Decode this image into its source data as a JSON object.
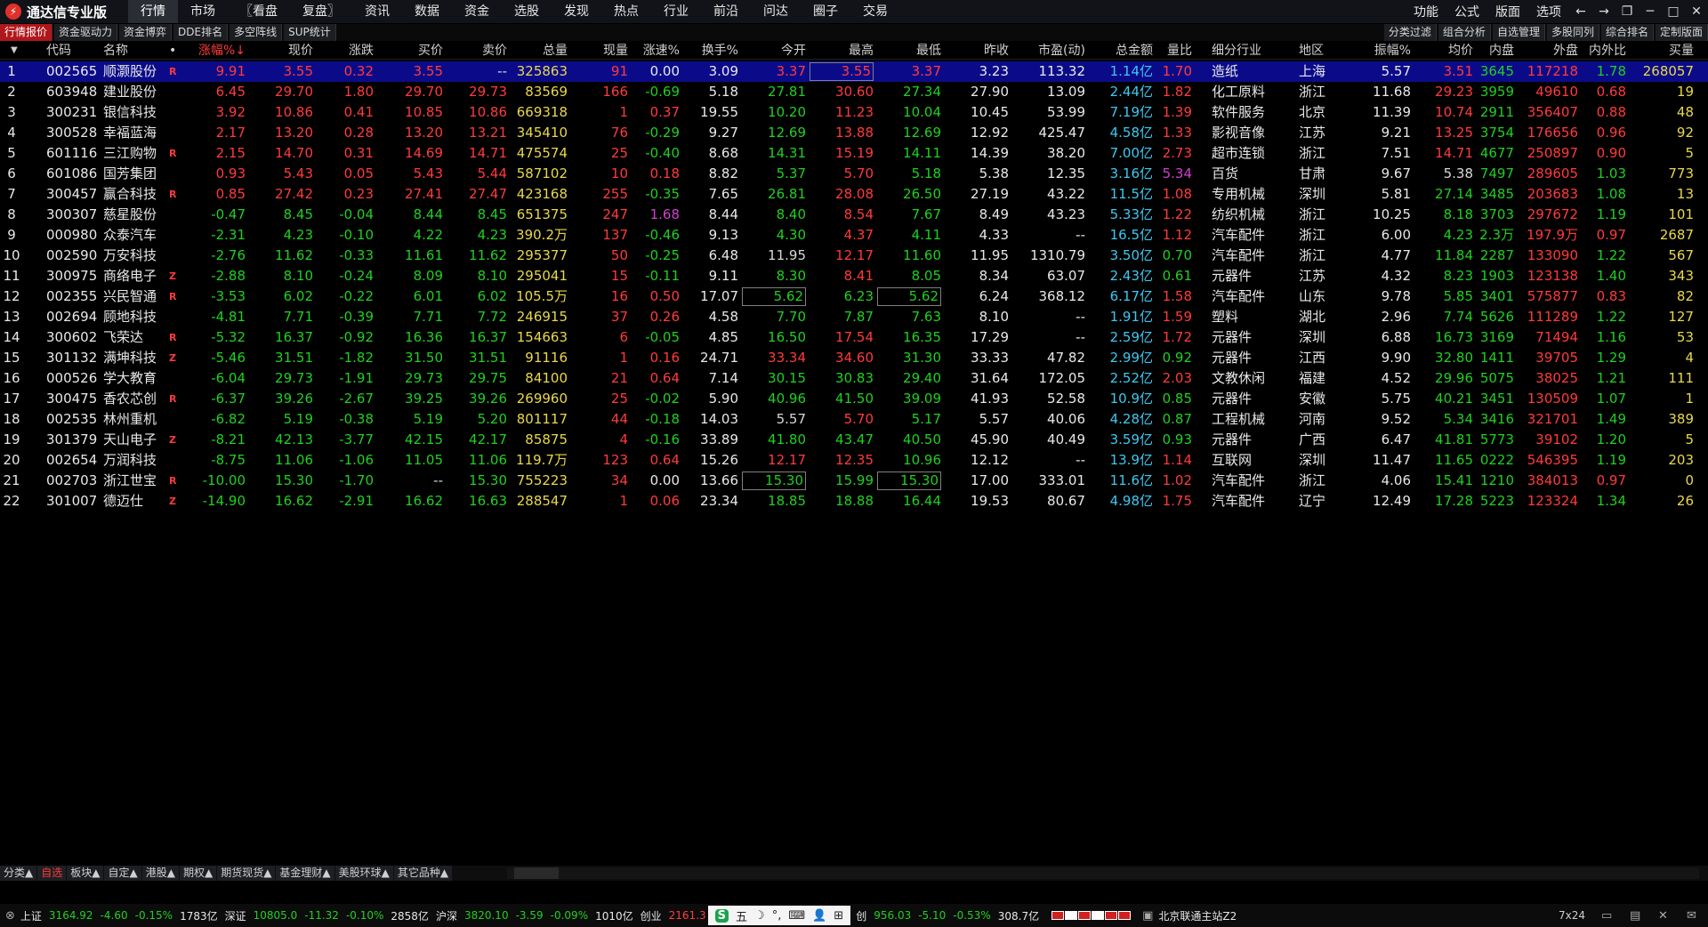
{
  "app": {
    "title": "通达信专业版",
    "logo_icon": "tdx-logo-icon"
  },
  "menu": [
    "行情",
    "市场",
    "〖看盘",
    "复盘〗",
    "资讯",
    "数据",
    "资金",
    "选股",
    "发现",
    "热点",
    "行业",
    "前沿",
    "问达",
    "圈子",
    "交易"
  ],
  "menu_active": 0,
  "top_right": [
    "功能",
    "公式",
    "版面",
    "选项"
  ],
  "window_icons": [
    "back-arrow-icon",
    "forward-arrow-icon",
    "restore-icon",
    "minimize-icon",
    "maximize-icon",
    "close-icon"
  ],
  "subtabs_left": [
    "行情报价",
    "资金驱动力",
    "资金博弈",
    "DDE排名",
    "多空阵线",
    "SUP统计"
  ],
  "subtabs_right": [
    "分类过滤",
    "组合分析",
    "自选管理",
    "多股同列",
    "综合排名",
    "定制版面"
  ],
  "columns": [
    "代码",
    "名称",
    "•",
    "涨幅%↓",
    "现价",
    "涨跌",
    "买价",
    "卖价",
    "总量",
    "现量",
    "涨速%",
    "换手%",
    "今开",
    "最高",
    "最低",
    "昨收",
    "市盈(动)",
    "总金额",
    "量比",
    "细分行业",
    "地区",
    "振幅%",
    "均价",
    "内盘",
    "外盘",
    "内外比",
    "买量"
  ],
  "rows": [
    {
      "n": "1",
      "code": "002565",
      "name": "顺灏股份",
      "flag": "R",
      "chg": "9.91",
      "price": "3.55",
      "diff": "0.32",
      "bid": "3.55",
      "ask": "--",
      "vol": "325863",
      "cur": "91",
      "spd": "0.00",
      "turn": "3.09",
      "open": "3.37",
      "high": "3.55",
      "low": "3.37",
      "prev": "3.23",
      "pe": "113.32",
      "amt": "1.14亿",
      "vr": "1.70",
      "ind": "造纸",
      "reg": "上海",
      "amp": "5.57",
      "avg": "3.51",
      "inner": "3645",
      "outer": "117218",
      "io": "1.78",
      "bv": "268057"
    },
    {
      "n": "2",
      "code": "603948",
      "name": "建业股份",
      "flag": "",
      "chg": "6.45",
      "price": "29.70",
      "diff": "1.80",
      "bid": "29.70",
      "ask": "29.73",
      "vol": "83569",
      "cur": "166",
      "spd": "-0.69",
      "turn": "5.18",
      "open": "27.81",
      "high": "30.60",
      "low": "27.34",
      "prev": "27.90",
      "pe": "13.09",
      "amt": "2.44亿",
      "vr": "1.82",
      "ind": "化工原料",
      "reg": "浙江",
      "amp": "11.68",
      "avg": "29.23",
      "inner": "3959",
      "outer": "49610",
      "io": "0.68",
      "bv": "19"
    },
    {
      "n": "3",
      "code": "300231",
      "name": "银信科技",
      "flag": "",
      "chg": "3.92",
      "price": "10.86",
      "diff": "0.41",
      "bid": "10.85",
      "ask": "10.86",
      "vol": "669318",
      "cur": "1",
      "spd": "0.37",
      "turn": "19.55",
      "open": "10.20",
      "high": "11.23",
      "low": "10.04",
      "prev": "10.45",
      "pe": "53.99",
      "amt": "7.19亿",
      "vr": "1.39",
      "ind": "软件服务",
      "reg": "北京",
      "amp": "11.39",
      "avg": "10.74",
      "inner": "2911",
      "outer": "356407",
      "io": "0.88",
      "bv": "48"
    },
    {
      "n": "4",
      "code": "300528",
      "name": "幸福蓝海",
      "flag": "",
      "chg": "2.17",
      "price": "13.20",
      "diff": "0.28",
      "bid": "13.20",
      "ask": "13.21",
      "vol": "345410",
      "cur": "76",
      "spd": "-0.29",
      "turn": "9.27",
      "open": "12.69",
      "high": "13.88",
      "low": "12.69",
      "prev": "12.92",
      "pe": "425.47",
      "amt": "4.58亿",
      "vr": "1.33",
      "ind": "影视音像",
      "reg": "江苏",
      "amp": "9.21",
      "avg": "13.25",
      "inner": "3754",
      "outer": "176656",
      "io": "0.96",
      "bv": "92"
    },
    {
      "n": "5",
      "code": "601116",
      "name": "三江购物",
      "flag": "R",
      "chg": "2.15",
      "price": "14.70",
      "diff": "0.31",
      "bid": "14.69",
      "ask": "14.71",
      "vol": "475574",
      "cur": "25",
      "spd": "-0.40",
      "turn": "8.68",
      "open": "14.31",
      "high": "15.19",
      "low": "14.11",
      "prev": "14.39",
      "pe": "38.20",
      "amt": "7.00亿",
      "vr": "2.73",
      "ind": "超市连锁",
      "reg": "浙江",
      "amp": "7.51",
      "avg": "14.71",
      "inner": "4677",
      "outer": "250897",
      "io": "0.90",
      "bv": "5"
    },
    {
      "n": "6",
      "code": "601086",
      "name": "国芳集团",
      "flag": "",
      "chg": "0.93",
      "price": "5.43",
      "diff": "0.05",
      "bid": "5.43",
      "ask": "5.44",
      "vol": "587102",
      "cur": "10",
      "spd": "0.18",
      "turn": "8.82",
      "open": "5.37",
      "high": "5.70",
      "low": "5.18",
      "prev": "5.38",
      "pe": "12.35",
      "amt": "3.16亿",
      "vr": "5.34",
      "ind": "百货",
      "reg": "甘肃",
      "amp": "9.67",
      "avg": "5.38",
      "inner": "7497",
      "outer": "289605",
      "io": "1.03",
      "bv": "773"
    },
    {
      "n": "7",
      "code": "300457",
      "name": "赢合科技",
      "flag": "R",
      "chg": "0.85",
      "price": "27.42",
      "diff": "0.23",
      "bid": "27.41",
      "ask": "27.47",
      "vol": "423168",
      "cur": "255",
      "spd": "-0.35",
      "turn": "7.65",
      "open": "26.81",
      "high": "28.08",
      "low": "26.50",
      "prev": "27.19",
      "pe": "43.22",
      "amt": "11.5亿",
      "vr": "1.08",
      "ind": "专用机械",
      "reg": "深圳",
      "amp": "5.81",
      "avg": "27.14",
      "inner": "3485",
      "outer": "203683",
      "io": "1.08",
      "bv": "13"
    },
    {
      "n": "8",
      "code": "300307",
      "name": "慈星股份",
      "flag": "",
      "chg": "-0.47",
      "price": "8.45",
      "diff": "-0.04",
      "bid": "8.44",
      "ask": "8.45",
      "vol": "651375",
      "cur": "247",
      "spd": "1.68",
      "turn": "8.44",
      "open": "8.40",
      "high": "8.54",
      "low": "7.67",
      "prev": "8.49",
      "pe": "43.23",
      "amt": "5.33亿",
      "vr": "1.22",
      "ind": "纺织机械",
      "reg": "浙江",
      "amp": "10.25",
      "avg": "8.18",
      "inner": "3703",
      "outer": "297672",
      "io": "1.19",
      "bv": "101"
    },
    {
      "n": "9",
      "code": "000980",
      "name": "众泰汽车",
      "flag": "",
      "chg": "-2.31",
      "price": "4.23",
      "diff": "-0.10",
      "bid": "4.22",
      "ask": "4.23",
      "vol": "390.2万",
      "cur": "137",
      "spd": "-0.46",
      "turn": "9.13",
      "open": "4.30",
      "high": "4.37",
      "low": "4.11",
      "prev": "4.33",
      "pe": "--",
      "amt": "16.5亿",
      "vr": "1.12",
      "ind": "汽车配件",
      "reg": "浙江",
      "amp": "6.00",
      "avg": "4.23",
      "inner": "2.3万",
      "outer": "197.9万",
      "io": "0.97",
      "bv": "2687"
    },
    {
      "n": "10",
      "code": "002590",
      "name": "万安科技",
      "flag": "",
      "chg": "-2.76",
      "price": "11.62",
      "diff": "-0.33",
      "bid": "11.61",
      "ask": "11.62",
      "vol": "295377",
      "cur": "50",
      "spd": "-0.25",
      "turn": "6.48",
      "open": "11.95",
      "high": "12.17",
      "low": "11.60",
      "prev": "11.95",
      "pe": "1310.79",
      "amt": "3.50亿",
      "vr": "0.70",
      "ind": "汽车配件",
      "reg": "浙江",
      "amp": "4.77",
      "avg": "11.84",
      "inner": "2287",
      "outer": "133090",
      "io": "1.22",
      "bv": "567"
    },
    {
      "n": "11",
      "code": "300975",
      "name": "商络电子",
      "flag": "Z",
      "chg": "-2.88",
      "price": "8.10",
      "diff": "-0.24",
      "bid": "8.09",
      "ask": "8.10",
      "vol": "295041",
      "cur": "15",
      "spd": "-0.11",
      "turn": "9.11",
      "open": "8.30",
      "high": "8.41",
      "low": "8.05",
      "prev": "8.34",
      "pe": "63.07",
      "amt": "2.43亿",
      "vr": "0.61",
      "ind": "元器件",
      "reg": "江苏",
      "amp": "4.32",
      "avg": "8.23",
      "inner": "1903",
      "outer": "123138",
      "io": "1.40",
      "bv": "343"
    },
    {
      "n": "12",
      "code": "002355",
      "name": "兴民智通",
      "flag": "R",
      "chg": "-3.53",
      "price": "6.02",
      "diff": "-0.22",
      "bid": "6.01",
      "ask": "6.02",
      "vol": "105.5万",
      "cur": "16",
      "spd": "0.50",
      "turn": "17.07",
      "open": "5.62",
      "high": "6.23",
      "low": "5.62",
      "prev": "6.24",
      "pe": "368.12",
      "amt": "6.17亿",
      "vr": "1.58",
      "ind": "汽车配件",
      "reg": "山东",
      "amp": "9.78",
      "avg": "5.85",
      "inner": "3401",
      "outer": "575877",
      "io": "0.83",
      "bv": "82"
    },
    {
      "n": "13",
      "code": "002694",
      "name": "顾地科技",
      "flag": "",
      "chg": "-4.81",
      "price": "7.71",
      "diff": "-0.39",
      "bid": "7.71",
      "ask": "7.72",
      "vol": "246915",
      "cur": "37",
      "spd": "0.26",
      "turn": "4.58",
      "open": "7.70",
      "high": "7.87",
      "low": "7.63",
      "prev": "8.10",
      "pe": "--",
      "amt": "1.91亿",
      "vr": "1.59",
      "ind": "塑料",
      "reg": "湖北",
      "amp": "2.96",
      "avg": "7.74",
      "inner": "5626",
      "outer": "111289",
      "io": "1.22",
      "bv": "127"
    },
    {
      "n": "14",
      "code": "300602",
      "name": "飞荣达",
      "flag": "R",
      "chg": "-5.32",
      "price": "16.37",
      "diff": "-0.92",
      "bid": "16.36",
      "ask": "16.37",
      "vol": "154663",
      "cur": "6",
      "spd": "-0.05",
      "turn": "4.85",
      "open": "16.50",
      "high": "17.54",
      "low": "16.35",
      "prev": "17.29",
      "pe": "--",
      "amt": "2.59亿",
      "vr": "1.72",
      "ind": "元器件",
      "reg": "深圳",
      "amp": "6.88",
      "avg": "16.73",
      "inner": "3169",
      "outer": "71494",
      "io": "1.16",
      "bv": "53"
    },
    {
      "n": "15",
      "code": "301132",
      "name": "满坤科技",
      "flag": "Z",
      "chg": "-5.46",
      "price": "31.51",
      "diff": "-1.82",
      "bid": "31.50",
      "ask": "31.51",
      "vol": "91116",
      "cur": "1",
      "spd": "0.16",
      "turn": "24.71",
      "open": "33.34",
      "high": "34.60",
      "low": "31.30",
      "prev": "33.33",
      "pe": "47.82",
      "amt": "2.99亿",
      "vr": "0.92",
      "ind": "元器件",
      "reg": "江西",
      "amp": "9.90",
      "avg": "32.80",
      "inner": "1411",
      "outer": "39705",
      "io": "1.29",
      "bv": "4"
    },
    {
      "n": "16",
      "code": "000526",
      "name": "学大教育",
      "flag": "",
      "chg": "-6.04",
      "price": "29.73",
      "diff": "-1.91",
      "bid": "29.73",
      "ask": "29.75",
      "vol": "84100",
      "cur": "21",
      "spd": "0.64",
      "turn": "7.14",
      "open": "30.15",
      "high": "30.83",
      "low": "29.40",
      "prev": "31.64",
      "pe": "172.05",
      "amt": "2.52亿",
      "vr": "2.03",
      "ind": "文教休闲",
      "reg": "福建",
      "amp": "4.52",
      "avg": "29.96",
      "inner": "5075",
      "outer": "38025",
      "io": "1.21",
      "bv": "111"
    },
    {
      "n": "17",
      "code": "300475",
      "name": "香农芯创",
      "flag": "R",
      "chg": "-6.37",
      "price": "39.26",
      "diff": "-2.67",
      "bid": "39.25",
      "ask": "39.26",
      "vol": "269960",
      "cur": "25",
      "spd": "-0.02",
      "turn": "5.90",
      "open": "40.96",
      "high": "41.50",
      "low": "39.09",
      "prev": "41.93",
      "pe": "52.58",
      "amt": "10.9亿",
      "vr": "0.85",
      "ind": "元器件",
      "reg": "安徽",
      "amp": "5.75",
      "avg": "40.21",
      "inner": "3451",
      "outer": "130509",
      "io": "1.07",
      "bv": "1"
    },
    {
      "n": "18",
      "code": "002535",
      "name": "林州重机",
      "flag": "",
      "chg": "-6.82",
      "price": "5.19",
      "diff": "-0.38",
      "bid": "5.19",
      "ask": "5.20",
      "vol": "801117",
      "cur": "44",
      "spd": "-0.18",
      "turn": "14.03",
      "open": "5.57",
      "high": "5.70",
      "low": "5.17",
      "prev": "5.57",
      "pe": "40.06",
      "amt": "4.28亿",
      "vr": "0.87",
      "ind": "工程机械",
      "reg": "河南",
      "amp": "9.52",
      "avg": "5.34",
      "inner": "3416",
      "outer": "321701",
      "io": "1.49",
      "bv": "389"
    },
    {
      "n": "19",
      "code": "301379",
      "name": "天山电子",
      "flag": "Z",
      "chg": "-8.21",
      "price": "42.13",
      "diff": "-3.77",
      "bid": "42.15",
      "ask": "42.17",
      "vol": "85875",
      "cur": "4",
      "spd": "-0.16",
      "turn": "33.89",
      "open": "41.80",
      "high": "43.47",
      "low": "40.50",
      "prev": "45.90",
      "pe": "40.49",
      "amt": "3.59亿",
      "vr": "0.93",
      "ind": "元器件",
      "reg": "广西",
      "amp": "6.47",
      "avg": "41.81",
      "inner": "5773",
      "outer": "39102",
      "io": "1.20",
      "bv": "5"
    },
    {
      "n": "20",
      "code": "002654",
      "name": "万润科技",
      "flag": "",
      "chg": "-8.75",
      "price": "11.06",
      "diff": "-1.06",
      "bid": "11.05",
      "ask": "11.06",
      "vol": "119.7万",
      "cur": "123",
      "spd": "0.64",
      "turn": "15.26",
      "open": "12.17",
      "high": "12.35",
      "low": "10.96",
      "prev": "12.12",
      "pe": "--",
      "amt": "13.9亿",
      "vr": "1.14",
      "ind": "互联网",
      "reg": "深圳",
      "amp": "11.47",
      "avg": "11.65",
      "inner": "0222",
      "outer": "546395",
      "io": "1.19",
      "bv": "203"
    },
    {
      "n": "21",
      "code": "002703",
      "name": "浙江世宝",
      "flag": "R",
      "chg": "-10.00",
      "price": "15.30",
      "diff": "-1.70",
      "bid": "--",
      "ask": "15.30",
      "vol": "755223",
      "cur": "34",
      "spd": "0.00",
      "turn": "13.66",
      "open": "15.30",
      "high": "15.99",
      "low": "15.30",
      "prev": "17.00",
      "pe": "333.01",
      "amt": "11.6亿",
      "vr": "1.02",
      "ind": "汽车配件",
      "reg": "浙江",
      "amp": "4.06",
      "avg": "15.41",
      "inner": "1210",
      "outer": "384013",
      "io": "0.97",
      "bv": "0"
    },
    {
      "n": "22",
      "code": "301007",
      "name": "德迈仕",
      "flag": "Z",
      "chg": "-14.90",
      "price": "16.62",
      "diff": "-2.91",
      "bid": "16.62",
      "ask": "16.63",
      "vol": "288547",
      "cur": "1",
      "spd": "0.06",
      "turn": "23.34",
      "open": "18.85",
      "high": "18.88",
      "low": "16.44",
      "prev": "19.53",
      "pe": "80.67",
      "amt": "4.98亿",
      "vr": "1.75",
      "ind": "汽车配件",
      "reg": "辽宁",
      "amp": "12.49",
      "avg": "17.28",
      "inner": "5223",
      "outer": "123324",
      "io": "1.34",
      "bv": "26"
    }
  ],
  "selected_row": 0,
  "bottom_tabs": [
    "分类▲",
    "自选",
    "板块▲",
    "自定▲",
    "港股▲",
    "期权▲",
    "期货现货▲",
    "基金理财▲",
    "美股环球▲",
    "其它品种▲"
  ],
  "bottom_active": 1,
  "status": {
    "sh_label": "上证",
    "sh_val": "3164.92",
    "sh_chg": "-4.60",
    "sh_pct": "-0.15%",
    "sh_amt": "1783亿",
    "sz_label": "深证",
    "sz_val": "10805.0",
    "sz_chg": "-11.32",
    "sz_pct": "-0.10%",
    "sz_amt": "2858亿",
    "hs_label": "沪深",
    "hs_val": "3820.10",
    "hs_chg": "-3.59",
    "hs_pct": "-0.09%",
    "hs_amt": "1010亿",
    "cy_label": "创业",
    "cy_val": "2161.3",
    "ime_items": [
      "S",
      "五",
      "☽",
      "°,",
      "⌨",
      "👤",
      "⊞"
    ],
    "kc_label": "创",
    "kc_val": "956.03",
    "kc_chg": "-5.10",
    "kc_pct": "-0.53%",
    "kc_amt": "308.7亿",
    "server": "北京联通主站Z2",
    "mode": "7x24"
  },
  "colors": {
    "up": "#ff3b3b",
    "down": "#20d020",
    "select": "#0b0b8a",
    "accent": "#b0161a"
  }
}
